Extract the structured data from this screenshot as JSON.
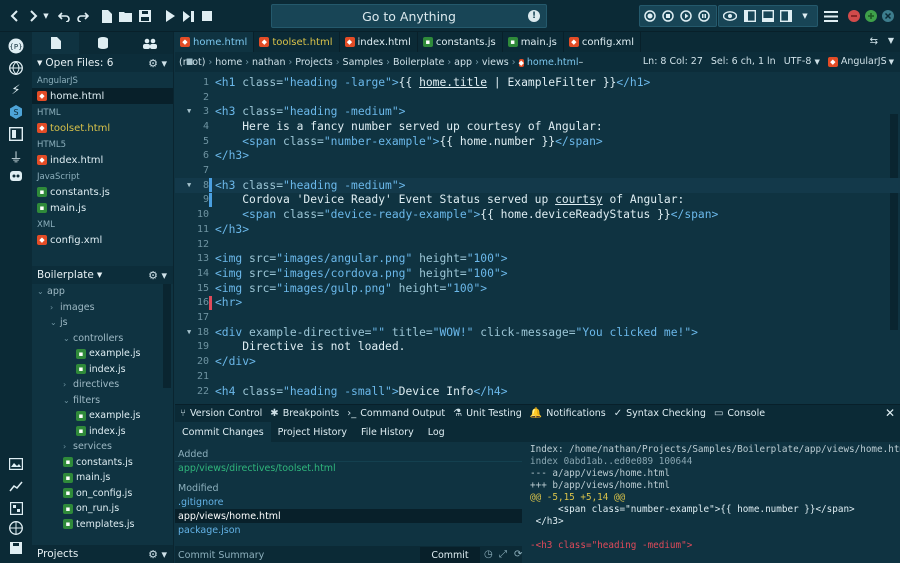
{
  "toolbar": {
    "goto_label": "Go to Anything"
  },
  "side_tabs": [
    "files-icon",
    "database-icon",
    "users-icon"
  ],
  "open_files": {
    "header": "Open Files: 6",
    "groups": [
      {
        "label": "AngularJS",
        "files": [
          {
            "name": "home.html",
            "kind": "html",
            "selected": true,
            "highlight": false
          }
        ]
      },
      {
        "label": "HTML",
        "files": [
          {
            "name": "toolset.html",
            "kind": "html",
            "selected": false,
            "highlight": true
          }
        ]
      },
      {
        "label": "HTML5",
        "files": [
          {
            "name": "index.html",
            "kind": "html",
            "selected": false,
            "highlight": false
          }
        ]
      },
      {
        "label": "JavaScript",
        "files": [
          {
            "name": "constants.js",
            "kind": "js",
            "selected": false,
            "highlight": false
          },
          {
            "name": "main.js",
            "kind": "js",
            "selected": false,
            "highlight": false
          }
        ]
      },
      {
        "label": "XML",
        "files": [
          {
            "name": "config.xml",
            "kind": "html",
            "selected": false,
            "highlight": false
          }
        ]
      }
    ]
  },
  "project": {
    "header": "Boilerplate",
    "tree": [
      {
        "name": "app",
        "depth": 0,
        "folder": true,
        "open": true
      },
      {
        "name": "images",
        "depth": 1,
        "folder": true,
        "open": false
      },
      {
        "name": "js",
        "depth": 1,
        "folder": true,
        "open": true
      },
      {
        "name": "controllers",
        "depth": 2,
        "folder": true,
        "open": true
      },
      {
        "name": "example.js",
        "depth": 3,
        "folder": false
      },
      {
        "name": "index.js",
        "depth": 3,
        "folder": false
      },
      {
        "name": "directives",
        "depth": 2,
        "folder": true,
        "open": false
      },
      {
        "name": "filters",
        "depth": 2,
        "folder": true,
        "open": true
      },
      {
        "name": "example.js",
        "depth": 3,
        "folder": false
      },
      {
        "name": "index.js",
        "depth": 3,
        "folder": false
      },
      {
        "name": "services",
        "depth": 2,
        "folder": true,
        "open": false
      },
      {
        "name": "constants.js",
        "depth": 2,
        "folder": false
      },
      {
        "name": "main.js",
        "depth": 2,
        "folder": false
      },
      {
        "name": "on_config.js",
        "depth": 2,
        "folder": false
      },
      {
        "name": "on_run.js",
        "depth": 2,
        "folder": false
      },
      {
        "name": "templates.js",
        "depth": 2,
        "folder": false
      }
    ],
    "footer": "Projects"
  },
  "tabs": [
    {
      "name": "home.html",
      "kind": "html",
      "active": true,
      "highlight": false
    },
    {
      "name": "toolset.html",
      "kind": "html",
      "active": false,
      "highlight": true
    },
    {
      "name": "index.html",
      "kind": "html",
      "active": false,
      "highlight": false
    },
    {
      "name": "constants.js",
      "kind": "js",
      "active": false,
      "highlight": false
    },
    {
      "name": "main.js",
      "kind": "js",
      "active": false,
      "highlight": false
    },
    {
      "name": "config.xml",
      "kind": "html",
      "active": false,
      "highlight": false
    }
  ],
  "breadcrumb": [
    "(root)",
    "home",
    "nathan",
    "Projects",
    "Samples",
    "Boilerplate",
    "app",
    "views",
    "home.html",
    "–"
  ],
  "status": {
    "position": "Ln: 8 Col: 27",
    "selection": "Sel: 6 ch, 1 ln",
    "encoding": "UTF-8",
    "language": "AngularJS"
  },
  "code_lines": [
    {
      "n": "1",
      "html": "<span class='tag'>&lt;h1 </span><span class='attr'>class=</span><span class='str'>\"heading -large\"</span><span class='tag'>&gt;</span><span class='txt'>{{ <u>home.title</u> | ExampleFilter }}</span><span class='tag'>&lt;/h1&gt;</span>"
    },
    {
      "n": "2",
      "html": ""
    },
    {
      "n": "3",
      "html": "<span class='tag'>&lt;h3 </span><span class='attr'>class=</span><span class='str'>\"heading -medium\"</span><span class='tag'>&gt;</span>"
    },
    {
      "n": "4",
      "html": "<span class='txt'>    Here is a fancy number served up courtesy of Angular:</span>"
    },
    {
      "n": "5",
      "html": "<span class='tag'>    &lt;span </span><span class='attr'>class=</span><span class='str'>\"number-example\"</span><span class='tag'>&gt;</span><span class='txt'>{{ home.number }}</span><span class='tag'>&lt;/span&gt;</span>"
    },
    {
      "n": "6",
      "html": "<span class='tag'>&lt;/h3&gt;</span>"
    },
    {
      "n": "7",
      "html": ""
    },
    {
      "n": "8",
      "html": "<span class='tag'>&lt;h3 </span><span class='attr'>class=</span><span class='str'>\"heading -medium\"</span><span class='tag'>&gt;</span>"
    },
    {
      "n": "9",
      "html": "<span class='txt'>    Cordova 'Device Ready' Event Status served up <u>courtsy</u> of Angular:</span>"
    },
    {
      "n": "10",
      "html": "<span class='tag'>    &lt;span </span><span class='attr'>class=</span><span class='str'>\"device-ready-example\"</span><span class='tag'>&gt;</span><span class='txt'>{{ home.deviceReadyStatus }}</span><span class='tag'>&lt;/span&gt;</span>"
    },
    {
      "n": "11",
      "html": "<span class='tag'>&lt;/h3&gt;</span>"
    },
    {
      "n": "12",
      "html": ""
    },
    {
      "n": "13",
      "html": "<span class='tag'>&lt;img </span><span class='attr'>src=</span><span class='str'>\"images/angular.png\"</span><span class='attr'> height=</span><span class='str'>\"100\"</span><span class='tag'>&gt;</span>"
    },
    {
      "n": "14",
      "html": "<span class='tag'>&lt;img </span><span class='attr'>src=</span><span class='str'>\"images/cordova.png\"</span><span class='attr'> height=</span><span class='str'>\"100\"</span><span class='tag'>&gt;</span>"
    },
    {
      "n": "15",
      "html": "<span class='tag'>&lt;img </span><span class='attr'>src=</span><span class='str'>\"images/gulp.png\"</span><span class='attr'> height=</span><span class='str'>\"100\"</span><span class='tag'>&gt;</span>"
    },
    {
      "n": "16",
      "html": "<span class='tag'>&lt;hr&gt;</span>"
    },
    {
      "n": "17",
      "html": ""
    },
    {
      "n": "18",
      "html": "<span class='tag'>&lt;div </span><span class='attr'>example-directive=</span><span class='str'>\"\"</span><span class='attr'> title=</span><span class='str'>\"WOW!\"</span><span class='attr'> click-message=</span><span class='str'>\"You clicked me!\"</span><span class='tag'>&gt;</span>"
    },
    {
      "n": "19",
      "html": "<span class='txt'>    Directive is not loaded.</span>"
    },
    {
      "n": "20",
      "html": "<span class='tag'>&lt;/div&gt;</span>"
    },
    {
      "n": "21",
      "html": ""
    },
    {
      "n": "22",
      "html": "<span class='tag'>&lt;h4 </span><span class='attr'>class=</span><span class='str'>\"heading -small\"</span><span class='tag'>&gt;</span><span class='txt'>Device Info</span><span class='tag'>&lt;/h4&gt;</span>"
    }
  ],
  "bottom_tabs": [
    {
      "label": "Version Control",
      "icon": "version-control-icon",
      "glyph": "⑂"
    },
    {
      "label": "Breakpoints",
      "icon": "breakpoints-icon",
      "glyph": "✱"
    },
    {
      "label": "Command Output",
      "icon": "terminal-icon",
      "glyph": "›_"
    },
    {
      "label": "Unit Testing",
      "icon": "flask-icon",
      "glyph": "⚗"
    },
    {
      "label": "Notifications",
      "icon": "bell-icon",
      "glyph": "🔔"
    },
    {
      "label": "Syntax Checking",
      "icon": "syntax-check-icon",
      "glyph": "✓"
    },
    {
      "label": "Console",
      "icon": "console-icon",
      "glyph": "▭"
    }
  ],
  "vc_tabs": [
    "Commit Changes",
    "Project History",
    "File History",
    "Log"
  ],
  "vc": {
    "added_label": "Added",
    "added": [
      "app/views/directives/toolset.html"
    ],
    "modified_label": "Modified",
    "modified": [
      ".gitignore",
      "app/views/home.html",
      "package.json"
    ],
    "selected": "app/views/home.html",
    "summary_placeholder": "Commit Summary",
    "commit_label": "Commit"
  },
  "diff": [
    {
      "cls": "meta",
      "text": "Index: /home/nathan/Projects/Samples/Boilerplate/app/views/home.html"
    },
    {
      "cls": "idx",
      "text": "index 0abd1ab..ed0e089 100644"
    },
    {
      "cls": "meta",
      "text": "--- a/app/views/home.html"
    },
    {
      "cls": "meta",
      "text": "+++ b/app/views/home.html"
    },
    {
      "cls": "hunk",
      "text": "@@ -5,15 +5,14 @@"
    },
    {
      "cls": "ctx",
      "text": "     <span class=\"number-example\">{{ home.number }}</span>"
    },
    {
      "cls": "ctx",
      "text": " </h3>"
    },
    {
      "cls": "ctx",
      "text": " "
    },
    {
      "cls": "del",
      "text": "-<h3 class=\"heading -medium\">"
    }
  ]
}
